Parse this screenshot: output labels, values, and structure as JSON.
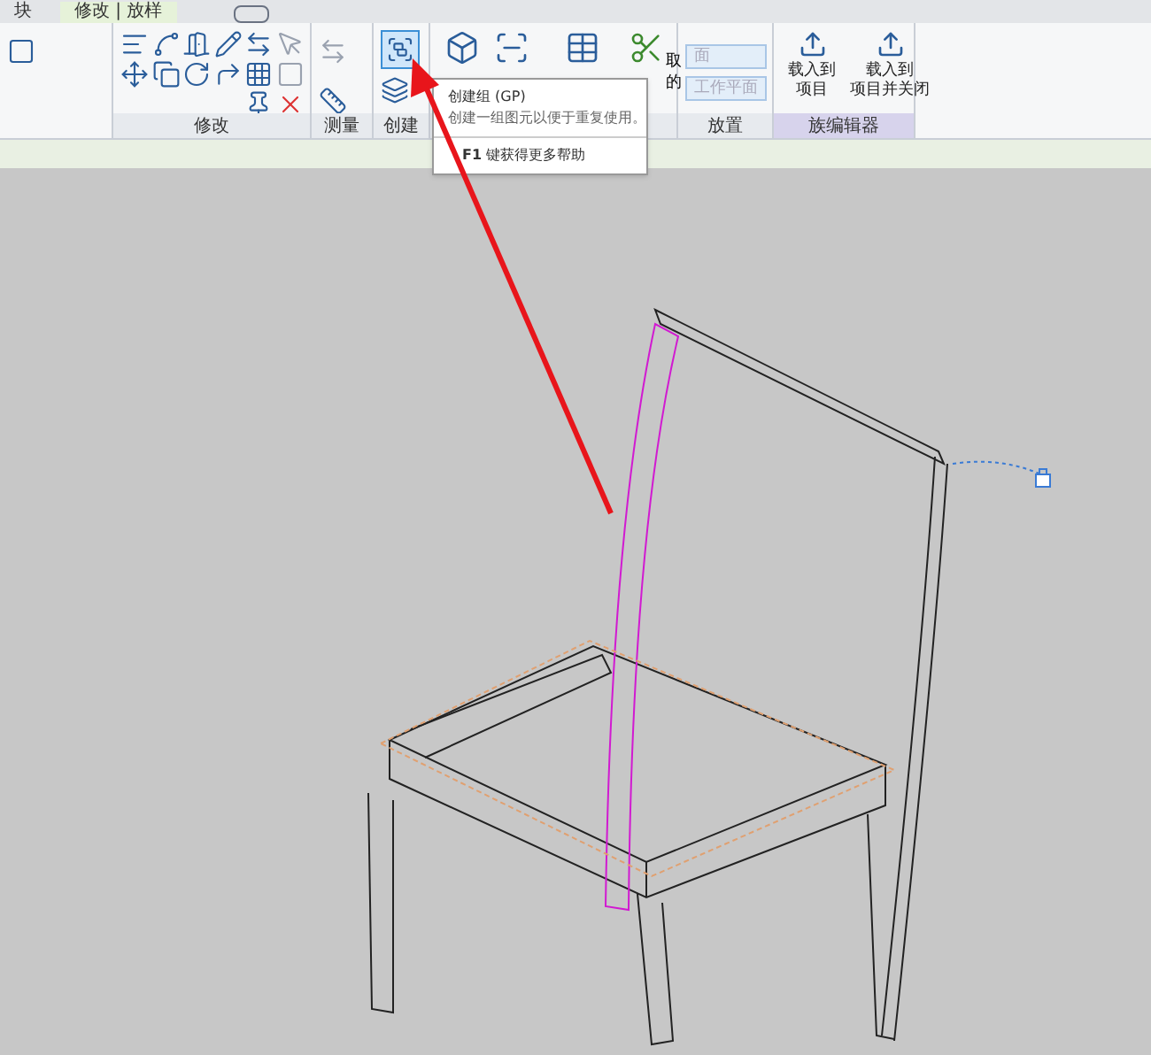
{
  "tabs": [
    {
      "label": "块",
      "selected": false
    },
    {
      "label": "修改 | 放样",
      "selected": true
    }
  ],
  "panels": [
    {
      "kind": "modify",
      "label": "修改"
    },
    {
      "kind": "measure",
      "label": "测量"
    },
    {
      "kind": "create",
      "label": "创建"
    },
    {
      "kind": "form"
    },
    {
      "kind": "place",
      "label": "放置",
      "buttons": [
        {
          "label": "面",
          "disabled": true
        },
        {
          "label": "工作平面",
          "disabled": true
        }
      ]
    },
    {
      "kind": "editor",
      "label": "族编辑器",
      "buttons": [
        {
          "lines": [
            "载入到",
            "项目"
          ]
        },
        {
          "lines": [
            "载入到",
            "项目并关闭"
          ]
        }
      ]
    }
  ],
  "partial_button": [
    "取",
    "的"
  ],
  "tooltip": {
    "title": "创建组 (GP)",
    "description": "创建一组图元以便于重复使用。",
    "help": "**F1** 键获得更多帮助"
  }
}
